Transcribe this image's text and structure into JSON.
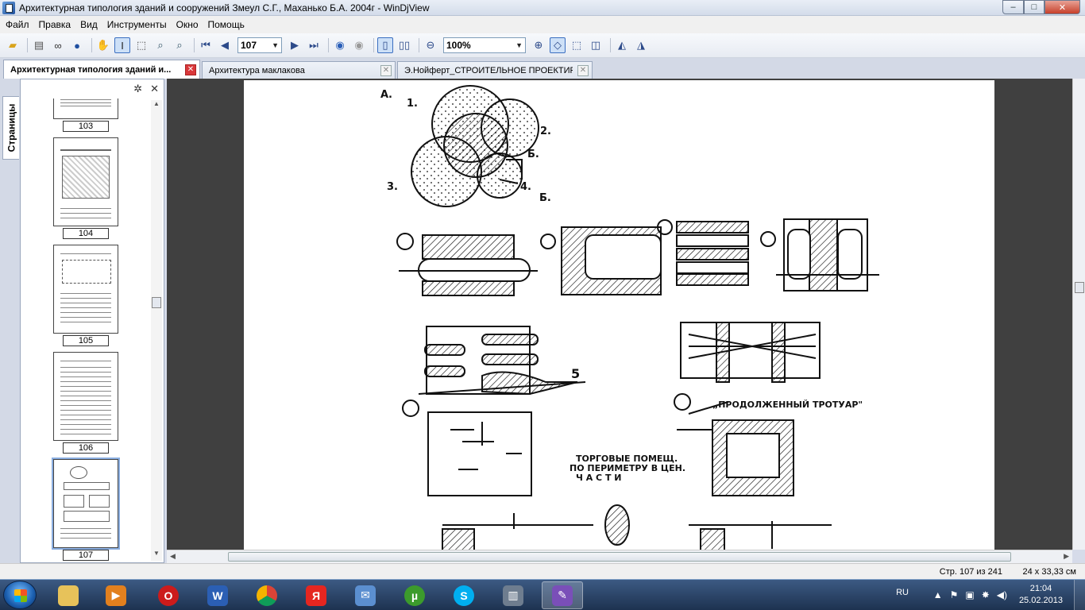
{
  "window": {
    "title": "Архитектурная типология зданий и сооружений Змеул С.Г., Маханько Б.А. 2004г - WinDjView",
    "minimize": "‒",
    "maximize": "□",
    "close": "✕"
  },
  "menu": [
    "Файл",
    "Правка",
    "Вид",
    "Инструменты",
    "Окно",
    "Помощь"
  ],
  "toolbar": {
    "page_value": "107",
    "zoom_value": "100%"
  },
  "tabs": [
    {
      "label": "Архитектурная типология зданий и...",
      "active": true
    },
    {
      "label": "Архитектура маклакова",
      "active": false
    },
    {
      "label": "Э.Нойферт_СТРОИТЕЛЬНОЕ ПРОЕКТИРО...",
      "active": false
    }
  ],
  "sidebar": {
    "vertical_tab": "Страницы",
    "thumbnails": [
      "103",
      "104",
      "105",
      "106",
      "107"
    ]
  },
  "document": {
    "labels": {
      "a": "А.",
      "n1": "1.",
      "n2": "2.",
      "n3": "3.",
      "n4": "4.",
      "b1": "Б.",
      "b2": "Б.",
      "five": "5",
      "caption1": "„ПРОДОЛЖЕННЫЙ ТРОТУАР\"",
      "caption2_l1": "ТОРГОВЫЕ ПОМЕЩ.",
      "caption2_l2": "ПО ПЕРИМЕТРУ В ЦЕН.",
      "caption2_l3": "Ч А С Т И"
    }
  },
  "status": {
    "page_info": "Стр. 107 из 241",
    "size_info": "24 x 33,33 см"
  },
  "taskbar": {
    "lang": "RU",
    "time": "21:04",
    "date": "25.02.2013"
  }
}
